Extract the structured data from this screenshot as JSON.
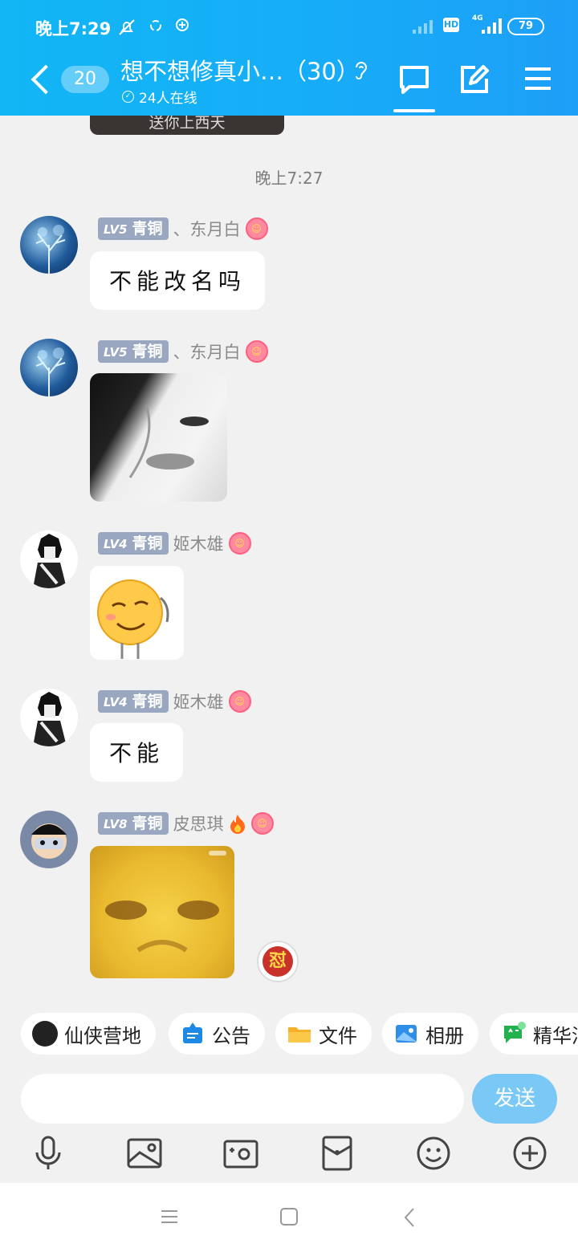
{
  "status_bar": {
    "time": "晚上7:29",
    "network": "4G",
    "hd": "HD",
    "battery": "79"
  },
  "header": {
    "unread_count": "20",
    "title": "想不想修真小…（30）",
    "online": "24人在线",
    "accent": "#16aef8"
  },
  "chat": {
    "cutoff_caption": "送你上西天",
    "time_divider": "晚上7:27",
    "messages": [
      {
        "level": "LV5",
        "rank": "青铜",
        "nick": "、东月白",
        "type": "text",
        "text": "不能改名吗"
      },
      {
        "level": "LV5",
        "rank": "青铜",
        "nick": "、东月白",
        "type": "sticker"
      },
      {
        "level": "LV4",
        "rank": "青铜",
        "nick": "姬木雄",
        "type": "sticker"
      },
      {
        "level": "LV4",
        "rank": "青铜",
        "nick": "姬木雄",
        "type": "text",
        "text": "不能"
      },
      {
        "level": "LV8",
        "rank": "青铜",
        "nick": "皮思琪",
        "type": "sticker",
        "react_glyph": "怼"
      }
    ]
  },
  "quickbar": {
    "items": [
      {
        "label": "仙侠营地",
        "icon": "camp-icon"
      },
      {
        "label": "公告",
        "icon": "announcement-icon"
      },
      {
        "label": "文件",
        "icon": "folder-icon"
      },
      {
        "label": "相册",
        "icon": "album-icon"
      },
      {
        "label": "精华消",
        "icon": "essence-icon"
      }
    ]
  },
  "composer": {
    "send_label": "发送"
  },
  "toolbar_icons": [
    "microphone-icon",
    "image-icon",
    "camera-icon",
    "red-packet-icon",
    "emoji-icon",
    "plus-icon"
  ]
}
